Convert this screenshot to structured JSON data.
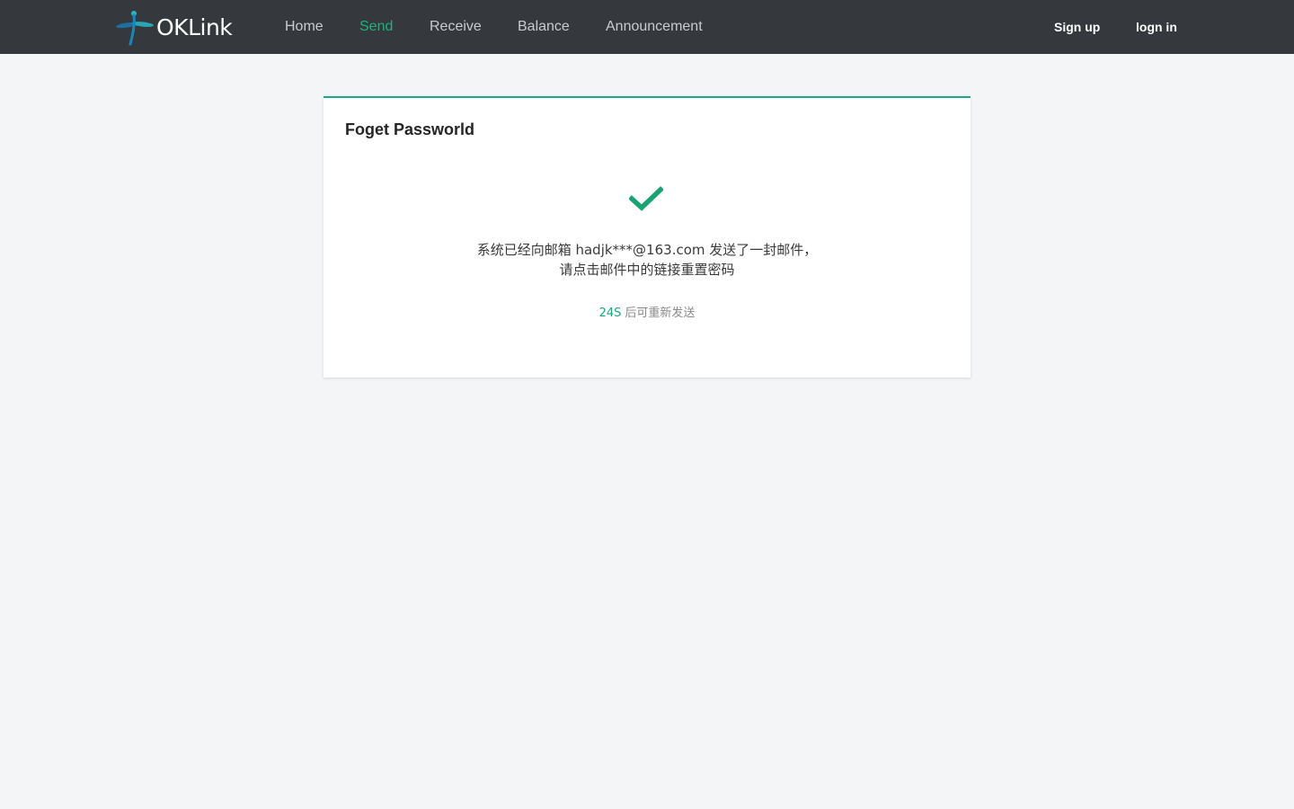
{
  "header": {
    "logo_text": "OKLink",
    "nav": {
      "home": "Home",
      "send": "Send",
      "receive": "Receive",
      "balance": "Balance",
      "announcement": "Announcement"
    },
    "auth": {
      "signup": "Sign up",
      "login": "logn in"
    }
  },
  "card": {
    "title": "Foget Passworld",
    "icon": "check-icon",
    "message_line1": "系统已经向邮箱 hadjk***@163.com 发送了一封邮件，",
    "message_line2": "请点击邮件中的链接重置密码",
    "countdown": "24S",
    "resend_text": "后可重新发送"
  },
  "colors": {
    "navbar_bg": "#35393d",
    "accent": "#1fb07d",
    "card_border": "#1aa886",
    "page_bg": "#f4f5f7"
  }
}
